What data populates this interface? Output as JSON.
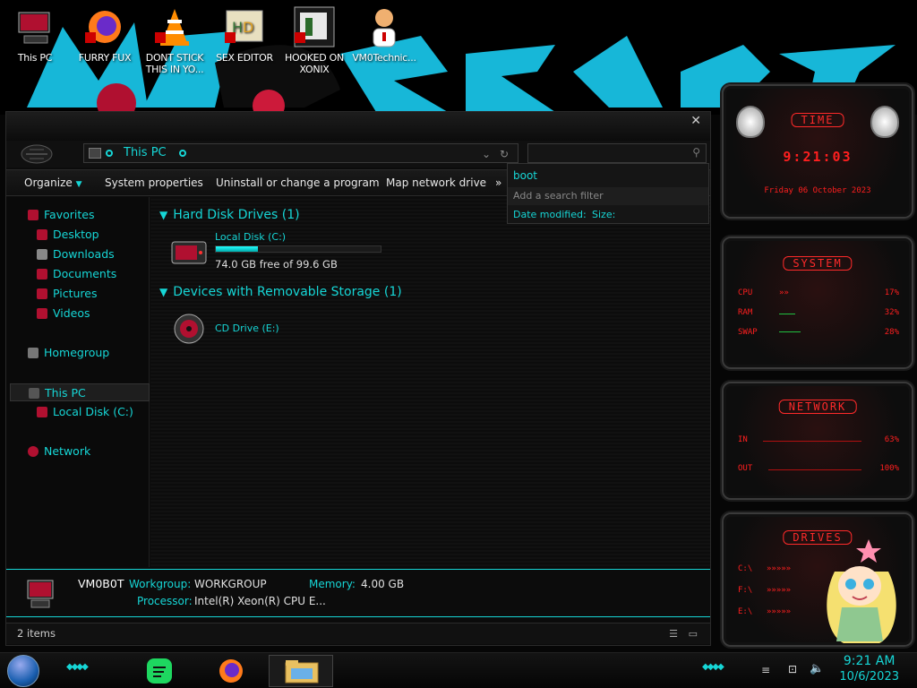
{
  "desktop": {
    "icons": [
      {
        "label": "This PC"
      },
      {
        "label": "FURRY FUX"
      },
      {
        "label": "DONT STICK THIS IN YO..."
      },
      {
        "label": "SEX EDITOR"
      },
      {
        "label": "HOOKED ON XONIX"
      },
      {
        "label": "VM0Technic..."
      }
    ]
  },
  "explorer": {
    "address": "This PC",
    "search_query": "boot",
    "search_add_filter": "Add a search filter",
    "filter_date": "Date modified:",
    "filter_size": "Size:",
    "toolbar": {
      "organize": "Organize",
      "system_properties": "System properties",
      "uninstall": "Uninstall or change a program",
      "map_drive": "Map network drive",
      "more": "»"
    },
    "nav": {
      "favorites": "Favorites",
      "desktop": "Desktop",
      "downloads": "Downloads",
      "documents": "Documents",
      "pictures": "Pictures",
      "videos": "Videos",
      "homegroup": "Homegroup",
      "this_pc": "This PC",
      "local_disk": "Local Disk (C:)",
      "network": "Network"
    },
    "groups": {
      "hdd": "Hard Disk Drives (1)",
      "removable": "Devices with Removable Storage (1)"
    },
    "drives": {
      "c_name": "Local Disk (C:)",
      "c_free": "74.0 GB free of 99.6 GB",
      "c_used_fraction": 0.257,
      "cd_name": "CD Drive (E:)"
    },
    "details": {
      "host": "VM0B0T",
      "workgroup_label": "Workgroup:",
      "workgroup": "WORKGROUP",
      "memory_label": "Memory:",
      "memory": "4.00 GB",
      "processor_label": "Processor:",
      "processor": "Intel(R) Xeon(R) CPU E..."
    },
    "status": "2 items"
  },
  "gadgets": {
    "time": {
      "title": "TIME",
      "clock": "9:21:03",
      "date": "Friday 06 October 2023"
    },
    "system": {
      "title": "SYSTEM",
      "rows": [
        {
          "label": "CPU",
          "value": "17%"
        },
        {
          "label": "RAM",
          "value": "32%"
        },
        {
          "label": "SWAP",
          "value": "28%"
        }
      ]
    },
    "network": {
      "title": "NETWORK",
      "in_label": "IN",
      "in_value": "63%",
      "out_label": "OUT",
      "out_value": "100%"
    },
    "drives": {
      "title": "DRIVES",
      "rows": [
        {
          "label": "C:\\"
        },
        {
          "label": "F:\\"
        },
        {
          "label": "E:\\"
        }
      ]
    }
  },
  "taskbar": {
    "time": "9:21 AM",
    "date": "10/6/2023"
  },
  "colors": {
    "accent": "#16d6d6",
    "red": "#ff1f1f"
  }
}
